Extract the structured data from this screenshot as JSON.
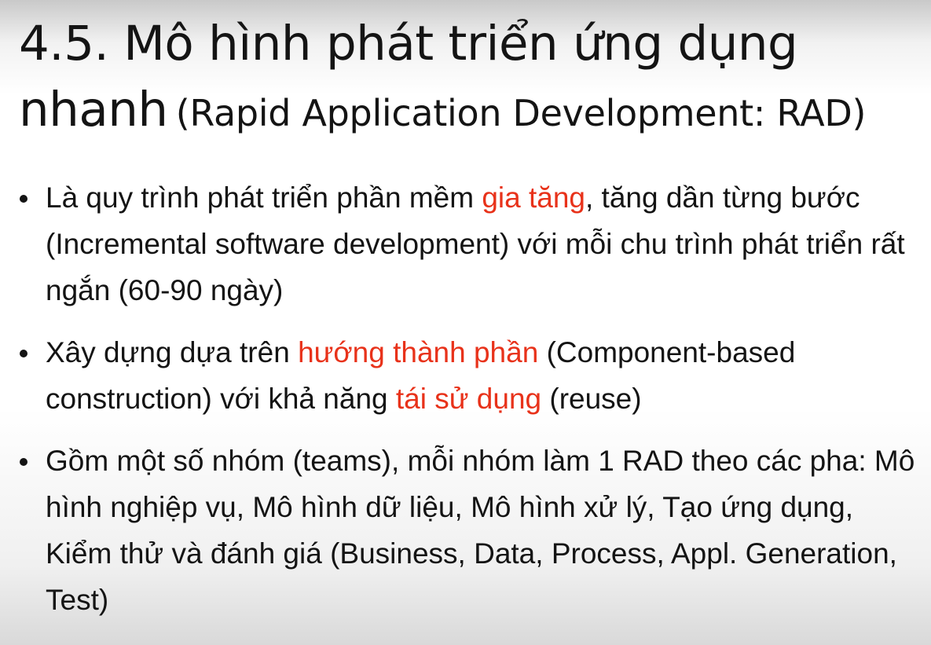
{
  "slide": {
    "title": {
      "line1": "4.5. Mô hình phát triển ứng dụng",
      "line2_main": "nhanh",
      "line2_sub": "(Rapid Application Development: RAD)"
    },
    "bullets": [
      {
        "segments": [
          {
            "text": "Là quy trình phát triển phần mềm ",
            "highlight": false
          },
          {
            "text": "gia tăng",
            "highlight": true
          },
          {
            "text": ", tăng dần từng bước (Incremental software development) với mỗi chu trình phát triển rất ngắn (60-90 ngày)",
            "highlight": false
          }
        ]
      },
      {
        "segments": [
          {
            "text": "Xây dựng dựa trên ",
            "highlight": false
          },
          {
            "text": "hướng thành phần",
            "highlight": true
          },
          {
            "text": " (Component-based construction) với khả năng ",
            "highlight": false
          },
          {
            "text": "tái sử dụng",
            "highlight": true
          },
          {
            "text": " (reuse)",
            "highlight": false
          }
        ]
      },
      {
        "segments": [
          {
            "text": "Gồm một số nhóm (teams), mỗi nhóm làm 1 RAD theo các pha: Mô hình nghiệp vụ, Mô hình dữ liệu, Mô hình xử lý, Tạo ứng dụng, Kiểm thử và đánh giá (Business, Data, Process, Appl. Generation, Test)",
            "highlight": false
          }
        ]
      }
    ]
  },
  "colors": {
    "text": "#141414",
    "highlight": "#e8321a"
  }
}
